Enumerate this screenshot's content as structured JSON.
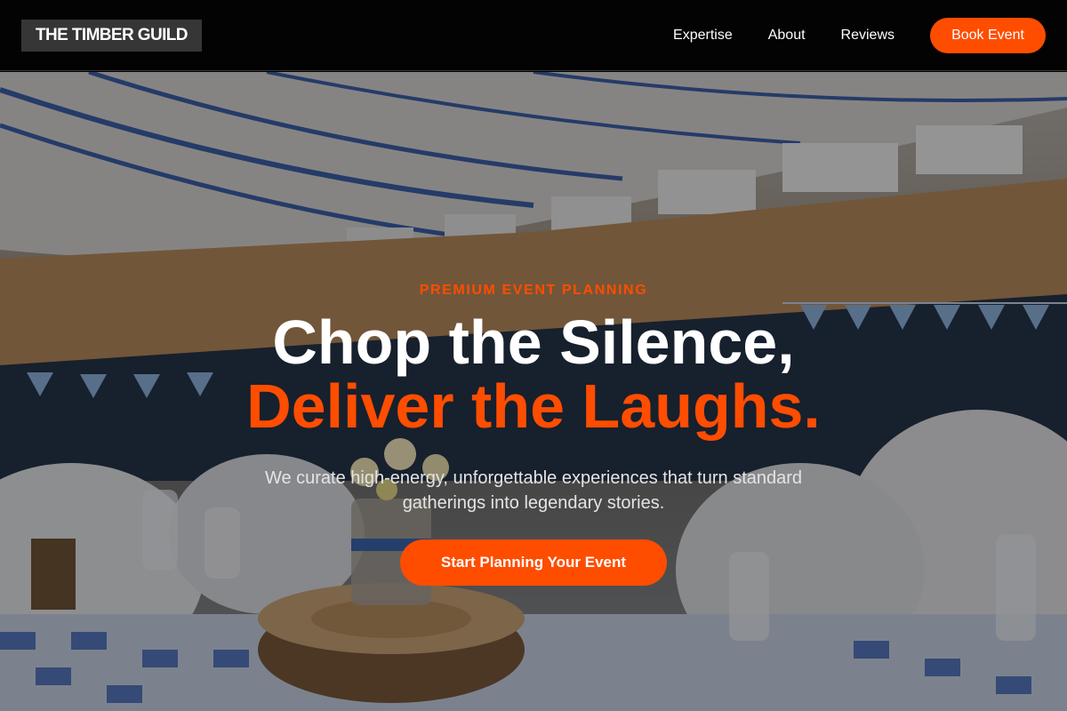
{
  "brand": {
    "name": "THE TIMBER GUILD"
  },
  "nav": {
    "links": [
      {
        "label": "Expertise"
      },
      {
        "label": "About"
      },
      {
        "label": "Reviews"
      }
    ],
    "cta_label": "Book Event"
  },
  "hero": {
    "eyebrow": "PREMIUM EVENT PLANNING",
    "headline_line1": "Chop the Silence,",
    "headline_line2": "Deliver the Laughs.",
    "subtext": "We curate high-energy, unforgettable experiences that turn standard gatherings into legendary stories.",
    "cta_label": "Start Planning Your Event",
    "background": "event-hall-banquet-photo"
  },
  "colors": {
    "accent": "#ff4d00",
    "nav_bg": "#030303",
    "logo_bg": "#363636",
    "text_light": "#ffffff"
  }
}
